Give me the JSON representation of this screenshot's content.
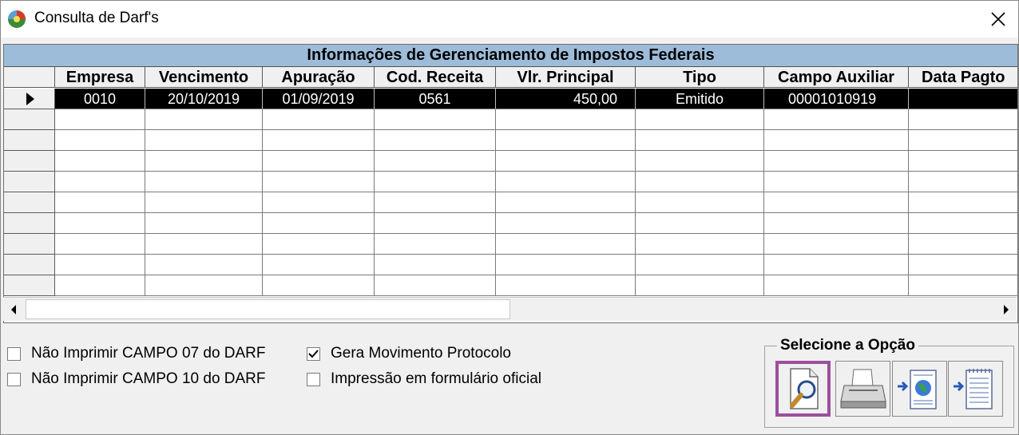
{
  "window": {
    "title": "Consulta de Darf's"
  },
  "grid": {
    "caption": "Informações de Gerenciamento de Impostos Federais",
    "columns": [
      "Empresa",
      "Vencimento",
      "Apuração",
      "Cod. Receita",
      "Vlr. Principal",
      "Tipo",
      "Campo Auxiliar",
      "Data Pagto"
    ],
    "rows": [
      [
        "0010",
        "20/10/2019",
        "01/09/2019",
        "0561",
        "450,00",
        "Emitido",
        "00001010919",
        ""
      ]
    ]
  },
  "options": {
    "nao_imprimir_07": {
      "label": "Não Imprimir CAMPO 07 do DARF",
      "checked": false
    },
    "nao_imprimir_10": {
      "label": "Não Imprimir CAMPO 10 do DARF",
      "checked": false
    },
    "gera_movimento": {
      "label": "Gera Movimento Protocolo",
      "checked": true
    },
    "formulario_oficial": {
      "label": "Impressão em formulário oficial",
      "checked": false
    }
  },
  "selecione": {
    "label": "Selecione a Opção",
    "buttons": [
      "preview-icon",
      "printer-icon",
      "export-web-icon",
      "export-document-icon"
    ]
  },
  "colors": {
    "caption_bg": "#9dbcd9",
    "selected_row": "#000000",
    "active_button_border": "#9c4f9c"
  }
}
